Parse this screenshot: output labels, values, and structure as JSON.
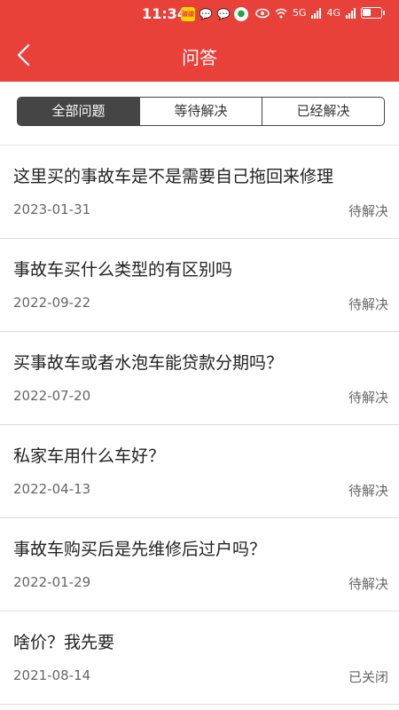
{
  "status_bar": {
    "time": "11:34",
    "badge_text": "碳碳",
    "network_left": "5G",
    "network_right": "4G"
  },
  "header": {
    "title": "问答"
  },
  "tabs": [
    {
      "label": "全部问题",
      "active": true
    },
    {
      "label": "等待解决",
      "active": false
    },
    {
      "label": "已经解决",
      "active": false
    }
  ],
  "questions": [
    {
      "title": "这里买的事故车是不是需要自己拖回来修理",
      "date": "2023-01-31",
      "status": "待解决"
    },
    {
      "title": "事故车买什么类型的有区别吗",
      "date": "2022-09-22",
      "status": "待解决"
    },
    {
      "title": "买事故车或者水泡车能贷款分期吗？",
      "date": "2022-07-20",
      "status": "待解决"
    },
    {
      "title": "私家车用什么车好？",
      "date": "2022-04-13",
      "status": "待解决"
    },
    {
      "title": "事故车购买后是先维修后过户吗？",
      "date": "2022-01-29",
      "status": "待解决"
    },
    {
      "title": "啥价？我先要",
      "date": "2021-08-14",
      "status": "已关闭"
    }
  ],
  "colors": {
    "brand": "#e8413a",
    "tab_active": "#454545"
  }
}
